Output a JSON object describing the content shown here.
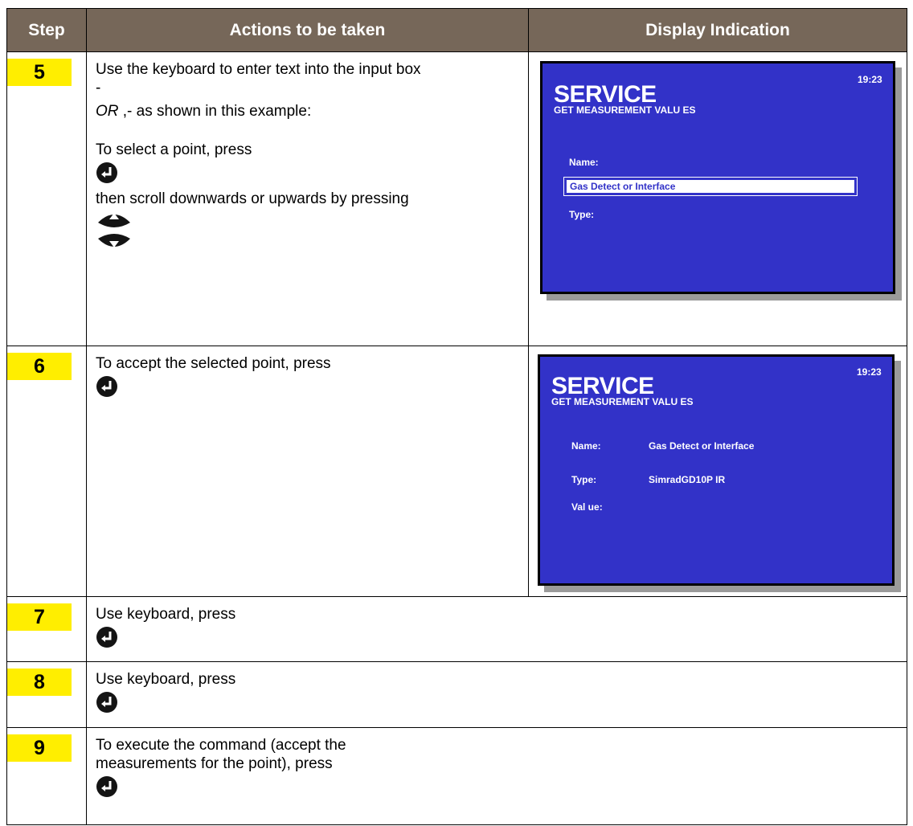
{
  "table": {
    "headers": {
      "step": "Step",
      "actions": "Actions to be taken",
      "display": "Display Indication"
    }
  },
  "rows": [
    {
      "step": "5",
      "lines": [
        "Use the keyboard to enter text into the input box",
        "-",
        "OR ,- as shown in this example:",
        "To select a point, press",
        "then scroll downwards or upwards by pressing"
      ]
    },
    {
      "step": "6",
      "lines": [
        "To accept the selected point, press"
      ]
    },
    {
      "step": "7",
      "lines": [
        "Use keyboard, press"
      ]
    },
    {
      "step": "8",
      "lines": [
        "Use keyboard, press"
      ]
    },
    {
      "step": "9",
      "lines": [
        "To execute the command (accept the",
        "measurements for the point), press"
      ]
    }
  ],
  "screens": [
    {
      "title": "SERVICE",
      "subtitle": "GET MEASUREMENT VALU ES",
      "time": "19:23",
      "name_label": "Name:",
      "input_value": "Gas Detect or Interface",
      "type_label": "Type:"
    },
    {
      "title": "SERVICE",
      "subtitle": "GET MEASUREMENT VALU ES",
      "time": "19:23",
      "name_label": "Name:",
      "name_value": "Gas Detect or Interface",
      "type_label": "Type:",
      "type_value": "SimradGD10P IR",
      "value_label": "Val ue:"
    }
  ],
  "icons": {
    "enter": "enter-key-icon",
    "up": "arrow-up-key-icon",
    "down": "arrow-down-key-icon"
  },
  "colors": {
    "header_bg": "#766759",
    "step_highlight": "#ffee00",
    "screen_bg": "#3232c8"
  }
}
